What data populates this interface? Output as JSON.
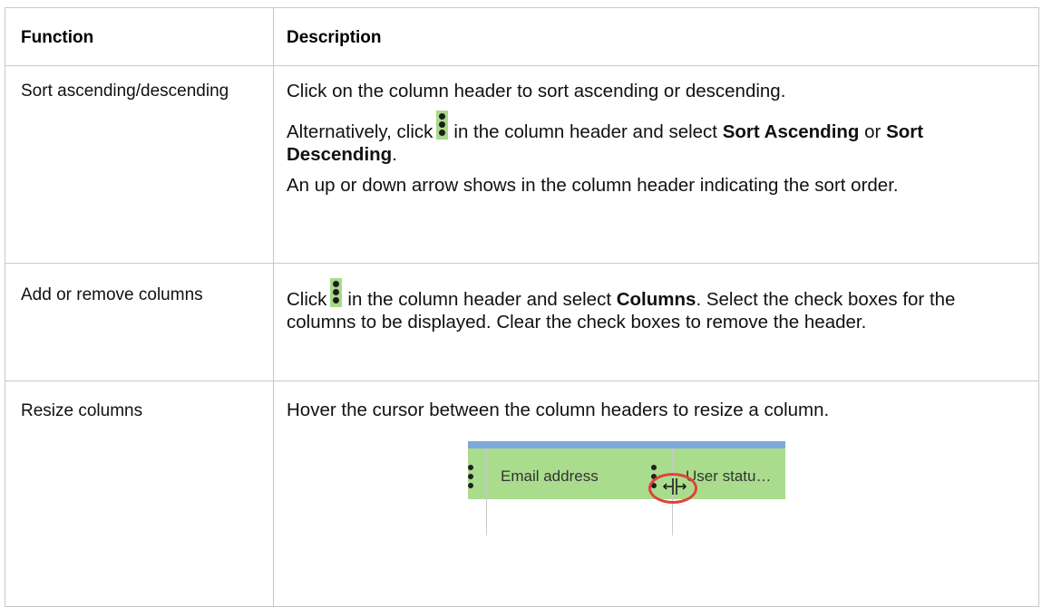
{
  "table": {
    "headers": {
      "function": "Function",
      "description": "Description"
    },
    "rows": [
      {
        "function": "Sort ascending/descending",
        "desc": {
          "p1": "Click on the column header to sort ascending or descending.",
          "p2_a": "Alternatively, click",
          "p2_b": "in the column header and select",
          "p2_bold1": "Sort Ascending",
          "p2_or": "or",
          "p2_bold2": "Sort Descending",
          "p2_end": ".",
          "p3": "An up or down arrow shows in the column header indicating the sort order."
        }
      },
      {
        "function": "Add or remove columns",
        "desc": {
          "p1_a": "Click",
          "p1_b": "in the column header and select",
          "p1_bold": "Columns",
          "p1_c": ". Select the check boxes for the columns to be displayed. Clear the check boxes to remove the header."
        }
      },
      {
        "function": "Resize columns",
        "desc": {
          "p1": "Hover the cursor between the column headers to resize a column."
        },
        "illustration": {
          "col1": "Email address",
          "col2": "User statu…"
        }
      }
    ]
  },
  "icons": {
    "column_menu": "kebab-menu-icon",
    "resize_cursor": "resize-cursor-icon",
    "highlight": "red-circle-highlight"
  },
  "colors": {
    "header_green": "#a9dc8d",
    "top_blue": "#7ea9dd",
    "highlight_red": "#e2413b",
    "border": "#c8c8c8"
  }
}
